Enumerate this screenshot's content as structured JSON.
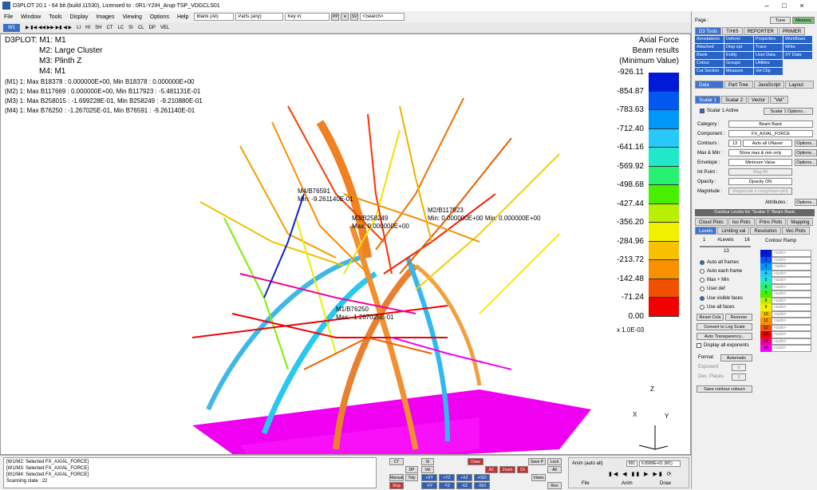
{
  "app": {
    "title": "D3PLOT 20.1 - 64 bit (build 11530), Licensed to : 0R1-Y2IH_Arup-TSP_VDGCLS01"
  },
  "menu": {
    "items": [
      "File",
      "Window",
      "Tools",
      "Display",
      "Images",
      "Viewing",
      "Options",
      "Help"
    ],
    "blank_select": "Blank (All)",
    "parts_select": "Parts (any)",
    "key_in": "Key in:",
    "pp": "PP",
    "sv": "SV",
    "search": "<Search>"
  },
  "toolbar": {
    "window_tab": "W1",
    "items": [
      "LI",
      "HI",
      "SH",
      "CT",
      "LC",
      "SI",
      "CL",
      "DP",
      "VEL"
    ]
  },
  "viewport": {
    "model_lines": [
      "D3PLOT: M1: M1",
      "M2: Large Cluster",
      "M3: Plinth Z",
      "M4: M1"
    ],
    "maxmin": [
      "(M1) 1: Max B18378 : 0.000000E+00, Min B18378 : 0.000000E+00",
      "(M2) 1: Max B117669 : 0.000000E+00, Min B117923 : -5.481131E-01",
      "(M3) 1: Max B258015 : -1.699228E-01, Min B258249 : -9.210880E-01",
      "(M4) 1: Max B76250 : -1.267025E-01, Min B76591 : -9.261140E-01"
    ],
    "annotations": [
      "M4/B76591",
      "Min: -9.261140E-01",
      "M2/B117923",
      "Min: 0.000000E+00 Min: 0.000000E+00",
      "M3/B258249",
      "Max: 0.000000E+00",
      "M1/B76250",
      "Max: -1.267025E-01"
    ],
    "legend": {
      "title": "Axial Force",
      "subtitle1": "Beam results",
      "subtitle2": "(Minimum Value)",
      "levels": [
        "-926.11",
        "-854.87",
        "-783.63",
        "-712.40",
        "-641.16",
        "-569.92",
        "-498.68",
        "-427.44",
        "-356.20",
        "-284.96",
        "-213.72",
        "-142.48",
        "-71.24",
        "0.00"
      ],
      "scale": "x  1.0E-03",
      "colors": [
        "#0018d8",
        "#0058f0",
        "#0098f8",
        "#28c8f8",
        "#20e8c8",
        "#28f070",
        "#48f000",
        "#b8f000",
        "#f0f000",
        "#f8c000",
        "#f89000",
        "#f05000",
        "#f00000",
        "#f00090",
        "#f800f8"
      ]
    },
    "axes": {
      "z": "Z",
      "x": "X",
      "y": "Y"
    }
  },
  "messages": [
    "[W1/M2: Selected FX_AXIAL_FORCE]",
    "[W1/M3: Selected FX_AXIAL_FORCE]",
    "[W1/M4: Selected FX_AXIAL_FORCE]"
  ],
  "scanning": "Scanning state :",
  "scanning_value": "22",
  "bottom_buttons": {
    "ct": "CT",
    "si": "SI",
    "draw": "Draw",
    "save_p": "Save P",
    "lock": "Lock",
    "dp": "DP",
    "vel": "Vel",
    "all": "All",
    "ac": "AC",
    "zoom": "Zoom",
    "ch": "Ch",
    "manual": "Manual",
    "tidy": "Tidy",
    "views": "Views",
    "stop": "Stop",
    "rev": "Rev",
    "axes": [
      "+XY",
      "+YZ",
      "+XZ",
      "+ISO",
      "-XY",
      "-YZ",
      "-XZ",
      "-ISO"
    ]
  },
  "anim": {
    "label": "Anim (auto all)",
    "frame": "6.8900E+01 (M1)",
    "frame_no": "891",
    "menus": [
      "File",
      "Anim",
      "Draw"
    ]
  },
  "right_panel": {
    "page": "Page :",
    "tune": "Tune",
    "memory": "Memory",
    "top_tabs": [
      "D3 Tools",
      "T/HIS",
      "REPORTER",
      "PRIMER"
    ],
    "tools_grid": [
      "Annotations",
      "Deform",
      "Properties",
      "Workflows",
      "Attached",
      "Disp opt",
      "Trace",
      "Write",
      "Blank",
      "Entity",
      "User Data",
      "XY Data",
      "Colour",
      "Groups",
      "Utilities",
      "",
      "Cut Section",
      "Measure",
      "Vol Clip",
      ""
    ],
    "sub_tabs": [
      "Data",
      "Part Tree",
      "JavaScript",
      "Layout"
    ],
    "scalar_tabs": [
      "Scalar 1",
      "Scalar 2",
      "Vector",
      "\"Vel\""
    ],
    "scalar_active": "Scalar 1 Active",
    "scalar_options": "Scalar 1 Options...",
    "fields": [
      {
        "label": "Category :",
        "value": "Beam Basic"
      },
      {
        "label": "Component :",
        "value": "FX_AXIAL_FORCE"
      }
    ],
    "contours_label": "Contours :",
    "contours_value": "13",
    "auto_naver": "Auto all UNaver",
    "options": "Options...",
    "maxmin_label": "Max & Min :",
    "maxmin_value": "Show max & min only",
    "envelope_label": "Envelope :",
    "envelope_value": "Minimum Value",
    "int_point_label": "Int Point :",
    "int_point_value": "Mag All",
    "opacity_label": "Opacity :",
    "opacity_value": "Opacity ON",
    "magnitude_label": "Magnitude :",
    "magnitude_value": "Magnitude x cos(phase+phi)",
    "attributes": "Attributes :",
    "contour_header": "Contour Levels for \"Scalar 1\" Beam Basic",
    "cl_tabs": [
      "Cloud Plots",
      "Iso Plots",
      "Princ Plots",
      "Mapping"
    ],
    "cl_tabs2": [
      "Levels",
      "Limiting val",
      "Resolution",
      "Vec Plots"
    ],
    "levels_min": "1",
    "levels_label": "#Levels",
    "levels_max": "16",
    "levels_value": "13",
    "contour_ramp": "Contour Ramp",
    "radios": [
      "Auto all frames",
      "Auto each frame",
      "Max + Min",
      "User def",
      "Use visible faces",
      "Use all faces"
    ],
    "reset_cols": "Reset Cols",
    "reverse": "Reverse",
    "log_scale": "Convert to Log Scale",
    "auto_transp": "Auto Transparency...",
    "display_exp": "Display all exponents",
    "format_label": "Format",
    "format_value": "Automatic",
    "exponent_label": "Exponent",
    "dec_places_label": "Dec. Places",
    "exponent_value": "0",
    "dec_places_value": "3",
    "save_colours": "Save contour colours",
    "ramp_nums": [
      "1",
      "2",
      "3",
      "4",
      "5",
      "6",
      "7",
      "8",
      "9",
      "10",
      "11",
      "12",
      "13",
      "14",
      "15"
    ],
    "ramp_auto": "<auto>"
  }
}
